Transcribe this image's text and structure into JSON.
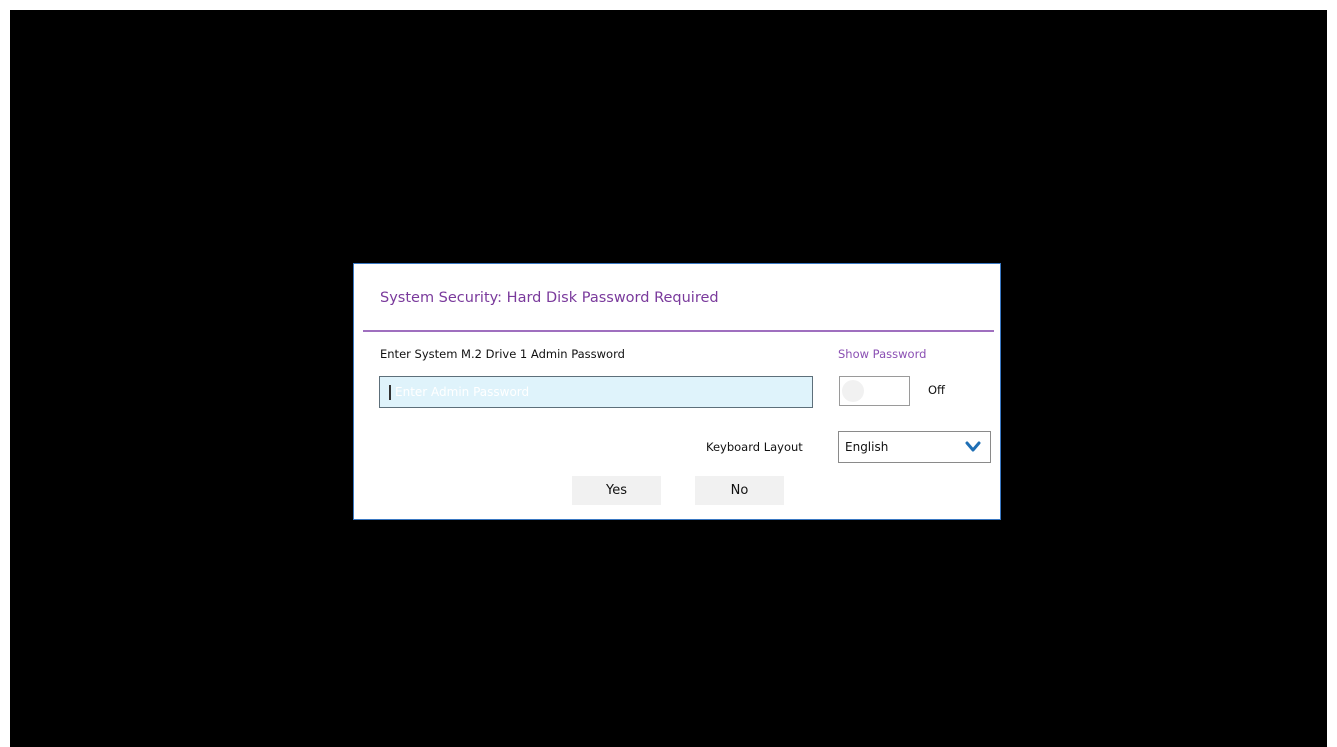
{
  "dialog": {
    "title": "System Security: Hard Disk Password Required",
    "field_label": "Enter System M.2 Drive 1 Admin Password",
    "password": {
      "value": "",
      "placeholder": "Enter Admin Password"
    },
    "show_password": {
      "label": "Show Password",
      "state": "Off"
    },
    "keyboard_layout": {
      "label": "Keyboard Layout",
      "selected": "English"
    },
    "buttons": {
      "yes": "Yes",
      "no": "No"
    }
  },
  "colors": {
    "accent_purple": "#7a3a9c",
    "input_background": "#dff3fb",
    "chevron_blue": "#1f6fb5",
    "screen_background": "#000000"
  },
  "icons": {
    "dropdown": "chevron-down-icon"
  }
}
